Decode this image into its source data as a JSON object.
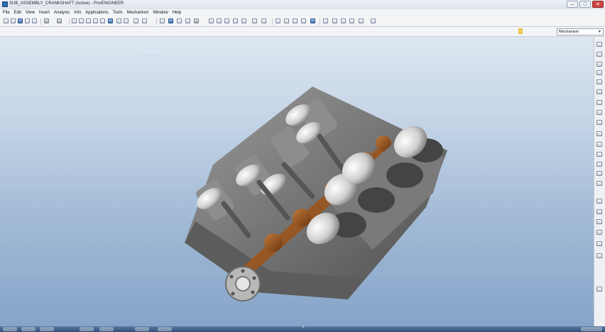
{
  "window": {
    "title": "SUB_ASSEMBLY_CRANKSHAFT (Active) - Pro/ENGINEER"
  },
  "menu": [
    "File",
    "Edit",
    "View",
    "Insert",
    "Analysis",
    "Info",
    "Applications",
    "Tools",
    "Mechanism",
    "Window",
    "Help"
  ],
  "filter": {
    "selected": "Mechanism"
  },
  "viewport": {
    "label": "T=n = 5.80"
  },
  "colors": {
    "background_top": "#dde7f1",
    "background_bottom": "#86a4c9",
    "crank": "#8a4a1e",
    "block": "#6e6e6e"
  }
}
